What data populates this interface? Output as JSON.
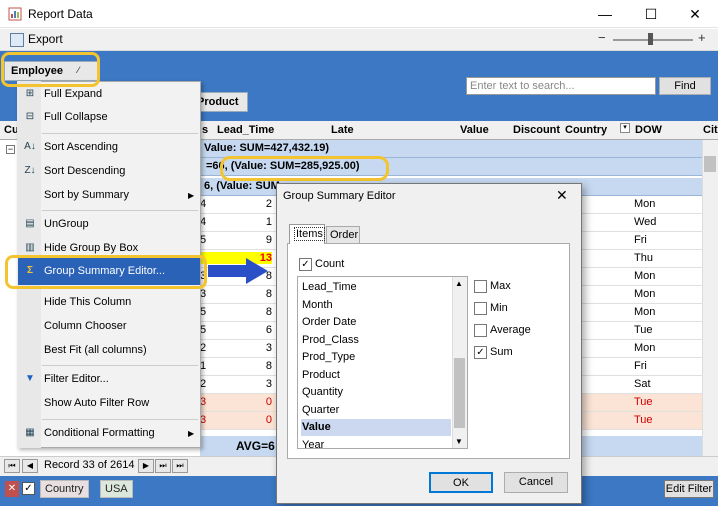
{
  "window": {
    "title": "Report Data",
    "minimize": "—",
    "maximize": "☐",
    "close": "✕"
  },
  "toolbar": {
    "export_label": "Export",
    "zoom_minus": "−",
    "zoom_plus": "+"
  },
  "groupbox": {
    "employee": "Employee",
    "product": "Product"
  },
  "search": {
    "placeholder": "Enter text to search...",
    "find_label": "Find"
  },
  "columns": {
    "cu": "Cu",
    "s": "s",
    "lead_time": "Lead_Time",
    "late": "Late",
    "value": "Value",
    "discount": "Discount",
    "country": "Country",
    "dow": "DOW",
    "cit": "Cit"
  },
  "summary_rows": [
    "Value: SUM=427,432.19)",
    "=66, (Value: SUM=285,925.00)",
    "6, (Value: SUM="
  ],
  "data_rows": [
    {
      "a": "4",
      "lead": "2",
      "dow": "Mon",
      "red": false
    },
    {
      "a": "4",
      "lead": "1",
      "dow": "Wed",
      "red": false
    },
    {
      "a": "5",
      "lead": "9",
      "dow": "Fri",
      "red": false
    },
    {
      "a": "",
      "lead": "13",
      "dow": "Thu",
      "red": false
    },
    {
      "a": "3",
      "lead": "8",
      "dow": "Mon",
      "red": false
    },
    {
      "a": "3",
      "lead": "8",
      "dow": "Mon",
      "red": false
    },
    {
      "a": "5",
      "lead": "8",
      "dow": "Mon",
      "red": false
    },
    {
      "a": "5",
      "lead": "6",
      "dow": "Tue",
      "red": false
    },
    {
      "a": "2",
      "lead": "3",
      "dow": "Mon",
      "red": false
    },
    {
      "a": "1",
      "lead": "8",
      "dow": "Fri",
      "red": false
    },
    {
      "a": "2",
      "lead": "3",
      "dow": "Sat",
      "red": false
    },
    {
      "a": "3",
      "lead": "0",
      "dow": "Tue",
      "red": true
    },
    {
      "a": "3",
      "lead": "0",
      "dow": "Tue",
      "red": true
    }
  ],
  "avg_row": "AVG=6",
  "navigator": {
    "first": "⏮",
    "prev": "◀",
    "record_text": "Record 33 of 2614",
    "next": "▶",
    "next_page": "⏭",
    "last": "⏭"
  },
  "filter": {
    "country": "Country",
    "usa": "USA",
    "edit_filter": "Edit Filter"
  },
  "menu": {
    "items": [
      {
        "label": "Full Expand",
        "icon": "expand-icon"
      },
      {
        "label": "Full Collapse",
        "icon": "collapse-icon"
      },
      {
        "label": "Sort Ascending",
        "icon": "sort-ascending-icon"
      },
      {
        "label": "Sort Descending",
        "icon": "sort-descending-icon"
      },
      {
        "label": "Sort by Summary",
        "icon": ""
      },
      {
        "label": "UnGroup",
        "icon": "ungroup-icon"
      },
      {
        "label": "Hide Group By Box",
        "icon": "hide-groupbox-icon"
      },
      {
        "label": "Group Summary Editor...",
        "icon": "sigma-icon"
      },
      {
        "label": "Hide This Column",
        "icon": ""
      },
      {
        "label": "Column Chooser",
        "icon": ""
      },
      {
        "label": "Best Fit (all columns)",
        "icon": ""
      },
      {
        "label": "Filter Editor...",
        "icon": "filter-icon"
      },
      {
        "label": "Show Auto Filter Row",
        "icon": ""
      },
      {
        "label": "Conditional Formatting",
        "icon": "conditional-formatting-icon"
      }
    ]
  },
  "dialog": {
    "title": "Group Summary Editor",
    "tabs": [
      "Items",
      "Order"
    ],
    "count_label": "Count",
    "fields": [
      "Lead_Time",
      "Month",
      "Order Date",
      "Prod_Class",
      "Prod_Type",
      "Product",
      "Quantity",
      "Quarter",
      "Value",
      "Year"
    ],
    "selected_field": "Value",
    "summary_options": [
      {
        "label": "Max",
        "checked": false
      },
      {
        "label": "Min",
        "checked": false
      },
      {
        "label": "Average",
        "checked": false
      },
      {
        "label": "Sum",
        "checked": true
      }
    ],
    "ok_label": "OK",
    "cancel_label": "Cancel"
  },
  "colors": {
    "grid_blue": "#3c78c3",
    "highlight": "#2a62b8",
    "callout": "#f4c430",
    "arrow": "#2b4fc6",
    "summary": "#c6d9f1"
  }
}
